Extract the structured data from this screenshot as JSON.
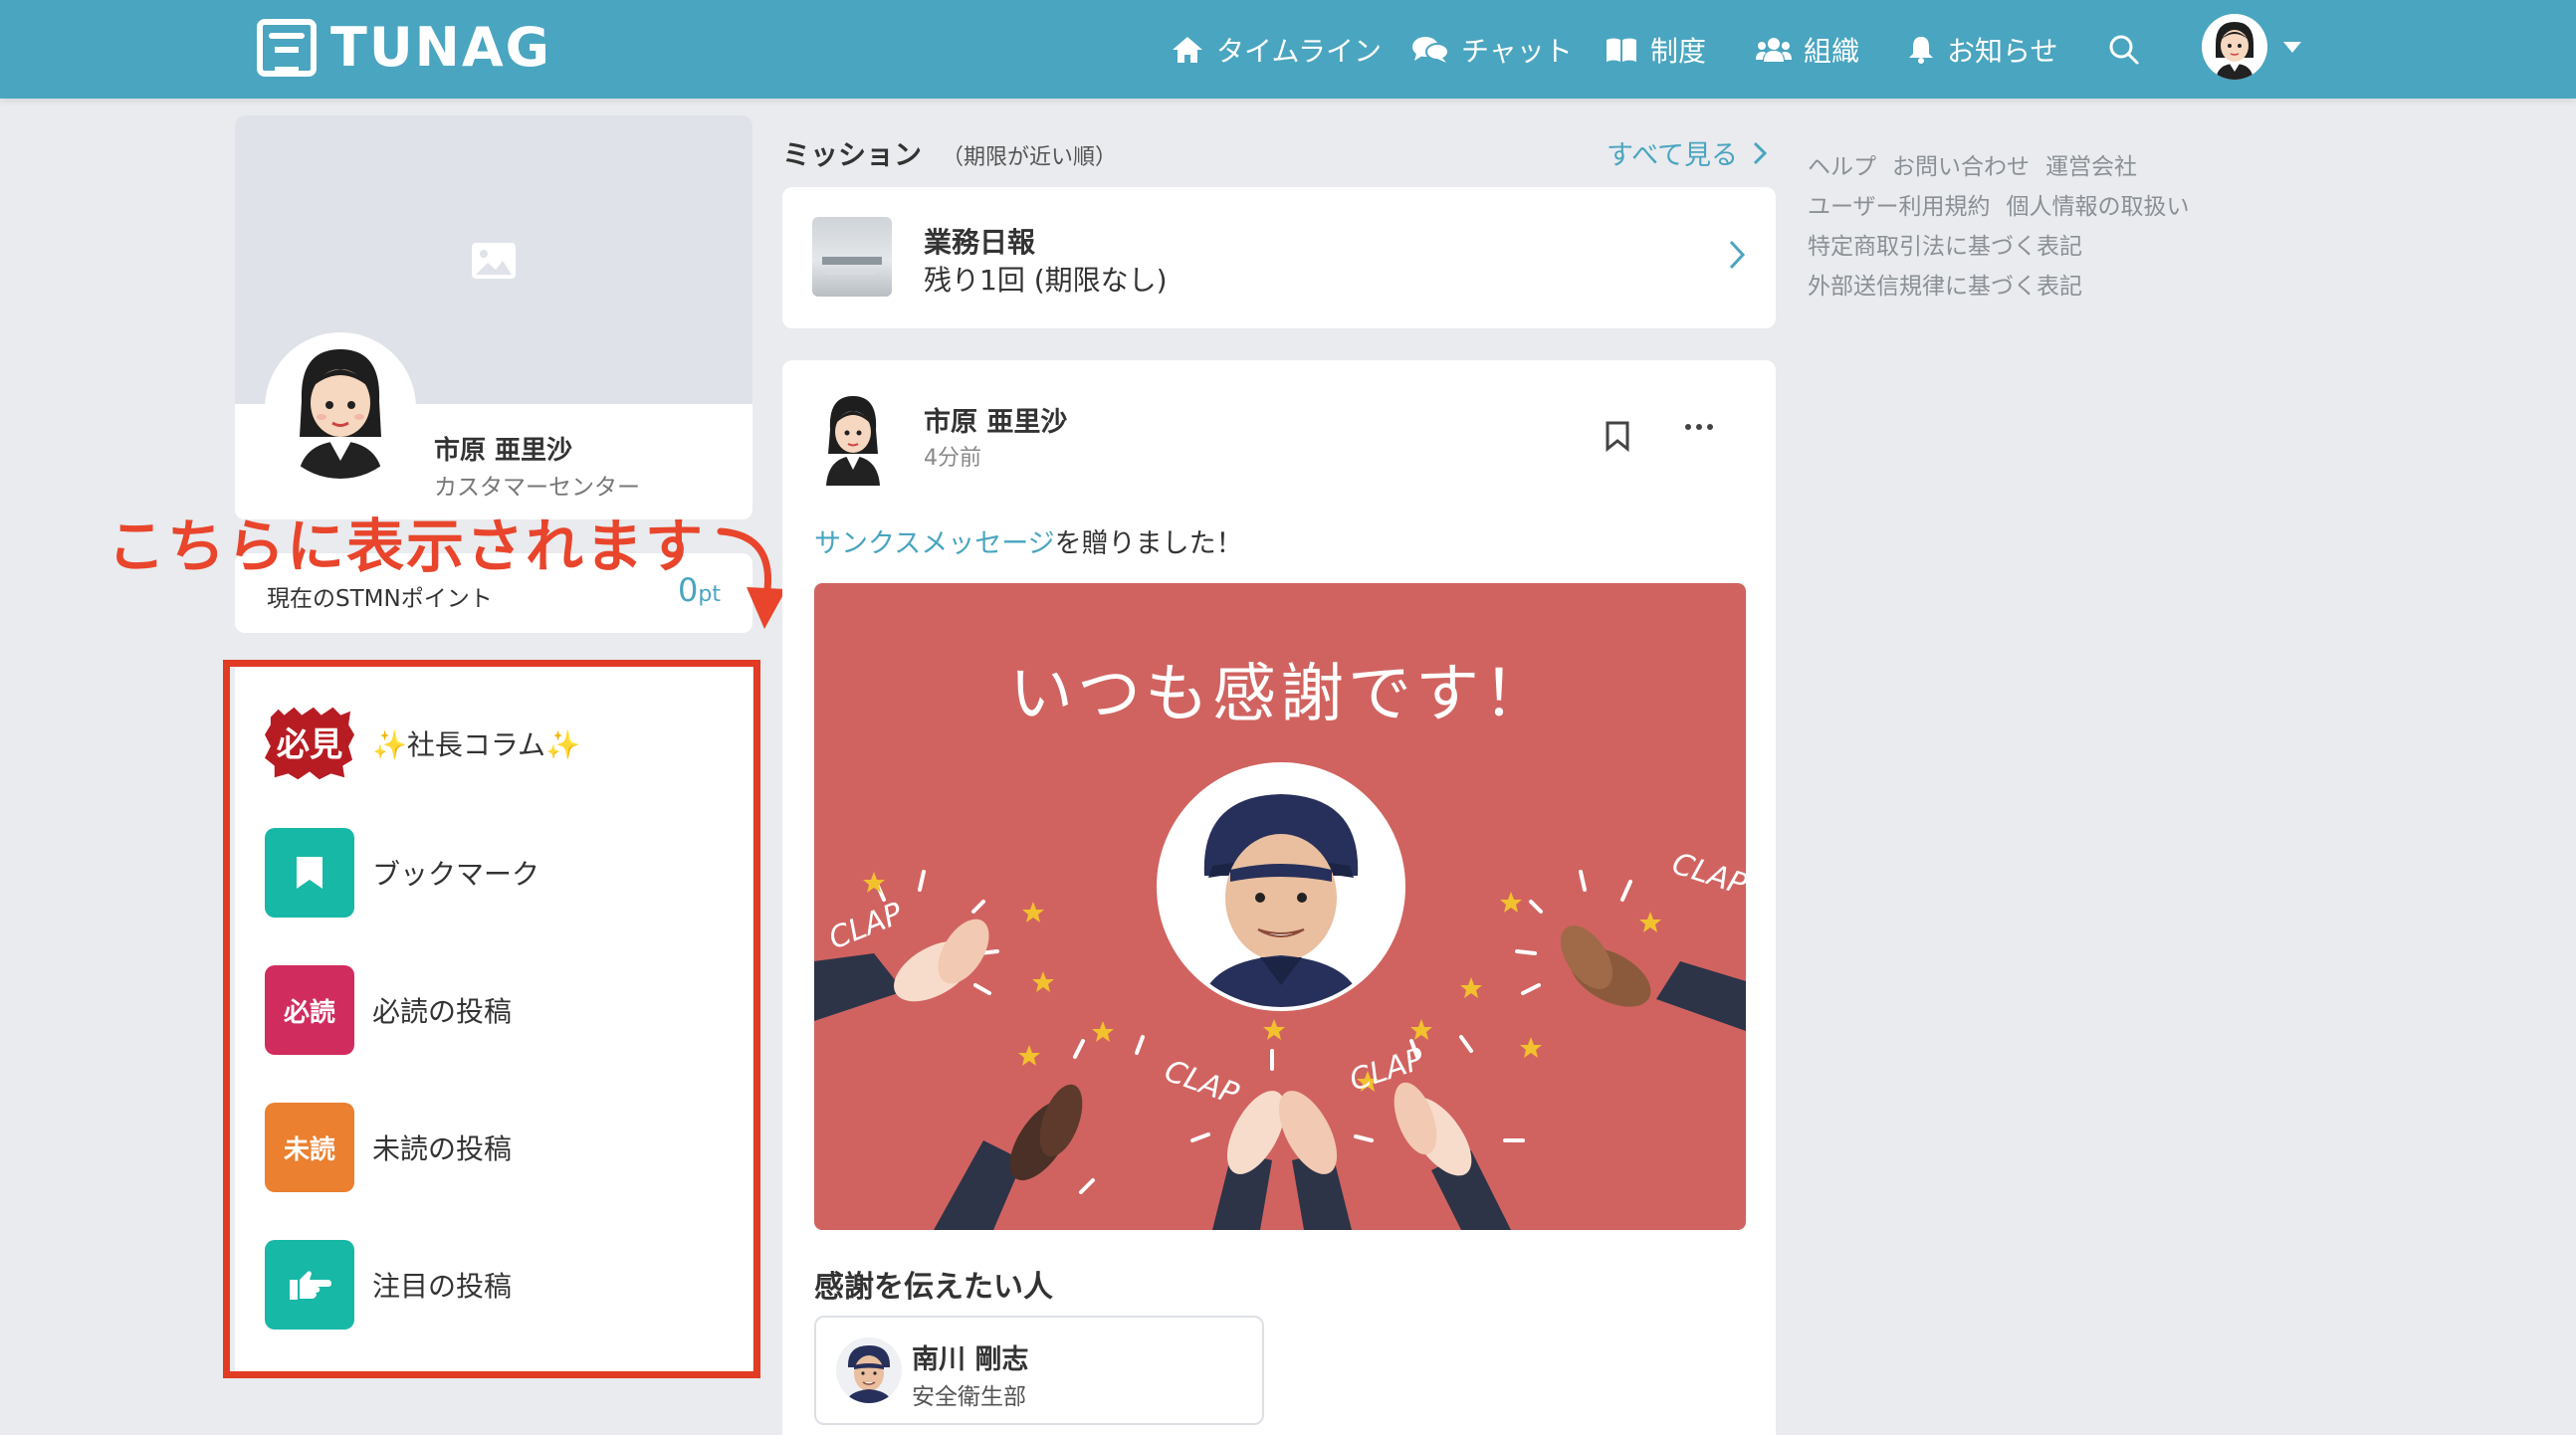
{
  "header": {
    "logo": "TUNAG",
    "nav": [
      {
        "label": "タイムライン",
        "icon": "home-icon"
      },
      {
        "label": "チャット",
        "icon": "chat-icon"
      },
      {
        "label": "制度",
        "icon": "book-icon"
      },
      {
        "label": "組織",
        "icon": "people-icon"
      },
      {
        "label": "お知らせ",
        "icon": "bell-icon"
      }
    ],
    "search_icon": "search-icon",
    "background": "#4aa5c0"
  },
  "profile": {
    "name": "市原 亜里沙",
    "department": "カスタマーセンター",
    "points_label": "現在のSTMNポイント",
    "points_value": "0",
    "points_unit": "pt"
  },
  "annotation": {
    "text": "こちらに表示されます",
    "color": "#e8452c"
  },
  "menu": {
    "items": [
      {
        "label": "✨社長コラム✨",
        "badge": "必見"
      },
      {
        "label": "ブックマーク"
      },
      {
        "label": "必読の投稿",
        "badge": "必読"
      },
      {
        "label": "未読の投稿",
        "badge": "未読"
      },
      {
        "label": "注目の投稿"
      }
    ]
  },
  "mission": {
    "title": "ミッション",
    "subtitle": "（期限が近い順）",
    "see_all": "すべて見る",
    "card": {
      "name": "業務日報",
      "remaining": "残り1回 (期限なし)"
    }
  },
  "post": {
    "author": "市原 亜里沙",
    "time": "4分前",
    "text_link": "サンクスメッセージ",
    "text_rest": "を贈りました！",
    "image_title": "いつも感謝です！",
    "clap_text": "CLAP",
    "receivers_title": "感謝を伝えたい人",
    "receiver": {
      "name": "南川 剛志",
      "department": "安全衛生部"
    }
  },
  "side_links": [
    "ヘルプ",
    "お問い合わせ",
    "運営会社",
    "ユーザー利用規約",
    "個人情報の取扱い",
    "特定商取引法に基づく表記",
    "外部送信規律に基づく表記"
  ]
}
